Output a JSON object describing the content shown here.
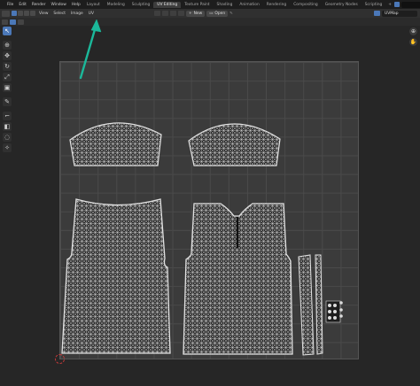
{
  "topbar": {
    "menus": [
      "File",
      "Edit",
      "Render",
      "Window",
      "Help"
    ],
    "workspaces": [
      "Layout",
      "Modeling",
      "Sculpting",
      "UV Editing",
      "Texture Paint",
      "Shading",
      "Animation",
      "Rendering",
      "Compositing",
      "Geometry Nodes",
      "Scripting"
    ],
    "active_workspace": "UV Editing",
    "add_workspace": "+",
    "viewlayer": ""
  },
  "editor_header": {
    "menus": [
      "View",
      "Select",
      "Image",
      "UV"
    ],
    "new_label": "New",
    "open_label": "Open",
    "uvmap_label": "UVMap"
  },
  "colors": {
    "accent": "#4b78b8",
    "annotation_arrow": "#1bb89a",
    "background": "#262626",
    "uv_grid": "#3b3b3b",
    "uv_fill": "#2a2a2a",
    "uv_wire": "#d8d8d8"
  },
  "toolbar": {
    "tools": [
      "select-tool",
      "cursor-tool",
      "move-tool",
      "rotate-tool",
      "scale-tool",
      "transform-tool",
      "annotate-tool",
      "rip-tool",
      "grab-tool",
      "relax-tool",
      "pinch-tool"
    ]
  },
  "nav": {
    "zoom_label": "⊕",
    "hand_label": "✋"
  },
  "uv_islands": [
    "sleeve-top-left",
    "sleeve-top-right",
    "shirt-back",
    "shirt-front",
    "collar-strip-left",
    "collar-strip-right",
    "button-cluster"
  ]
}
